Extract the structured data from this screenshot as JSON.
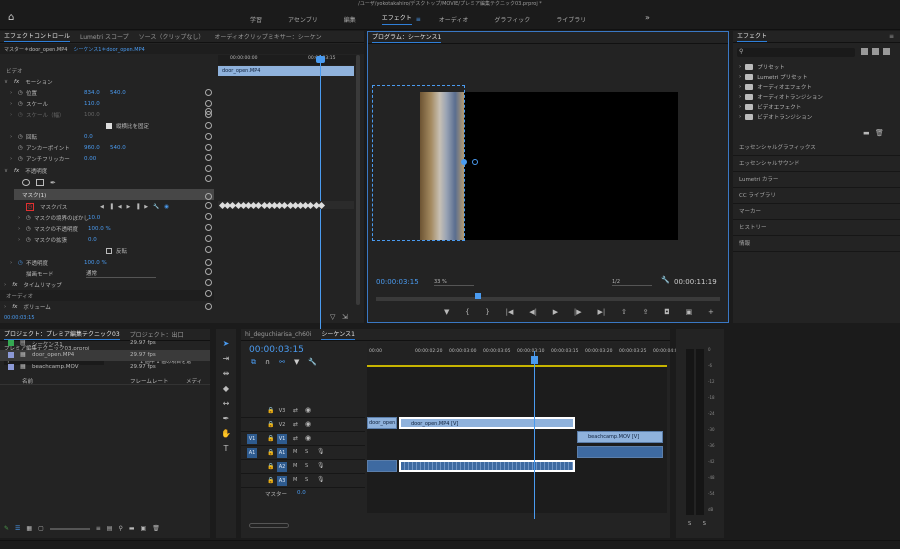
{
  "titlebar": {
    "title": "/ユーザ/yokotakahiro/デスクトップ/MOVIE/プレミア編集テクニック03.prproj *"
  },
  "workspaces": {
    "items": [
      "学習",
      "アセンブリ",
      "編集",
      "エフェクト",
      "オーディオ",
      "グラフィック",
      "ライブラリ"
    ],
    "active": "エフェクト"
  },
  "effect_controls": {
    "tabs": [
      "エフェクトコントロール",
      "Lumetri スコープ",
      "ソース（クリップなし）",
      "オーディオクリップミキサー：シーケン"
    ],
    "master": "マスター＊door_open.MP4",
    "sequence_clip": "シーケンス1＊door_open.MP4",
    "video_label": "ビデオ",
    "ruler_start": "00:00:00:00",
    "ruler_mid": "00:00:03:15",
    "clip_name": "door_open.MP4",
    "motion": "モーション",
    "position_label": "位置",
    "position_x": "834.0",
    "position_y": "540.0",
    "scale_label": "スケール",
    "scale_value": "110.0",
    "scale_width_label": "スケール（幅）",
    "scale_width_value": "100.0",
    "uniform_label": "縦横比を固定",
    "rotation_label": "回転",
    "rotation_value": "0.0",
    "anchor_label": "アンカーポイント",
    "anchor_x": "960.0",
    "anchor_y": "540.0",
    "flicker_label": "アンチフリッカー",
    "flicker_value": "0.00",
    "opacity_section": "不透明度",
    "mask_label": "マスク(1)",
    "mask_path_label": "マスクパス",
    "mask_feather_label": "マスクの境界のぼかし",
    "mask_feather_value": "10.0",
    "mask_opacity_label": "マスクの不透明度",
    "mask_opacity_value": "100.0 %",
    "mask_expansion_label": "マスクの拡張",
    "mask_expansion_value": "0.0",
    "invert_label": "反転",
    "opacity_label": "不透明度",
    "opacity_value": "100.0 %",
    "blend_label": "描画モード",
    "blend_value": "通常",
    "time_remap": "タイムリマップ",
    "audio_label": "オーディオ",
    "volume_label": "ボリューム",
    "timecode": "00:00:03:15"
  },
  "program": {
    "title": "プログラム：シーケンス1",
    "timecode": "00:00:03:15",
    "zoom": "33 %",
    "quality": "1/2",
    "duration": "00:00:11:19"
  },
  "effects": {
    "title": "エフェクト",
    "tree": [
      "プリセット",
      "Lumetri プリセット",
      "オーディオエフェクト",
      "オーディオトランジション",
      "ビデオエフェクト",
      "ビデオトランジション"
    ],
    "sections": [
      "エッセンシャルグラフィックス",
      "エッセンシャルサウンド",
      "Lumetri カラー",
      "CC ライブラリ",
      "マーカー",
      "ヒストリー",
      "情報"
    ]
  },
  "project": {
    "tabs": [
      "プロジェクト：プレミア編集テクニック03",
      "プロジェクト：出口"
    ],
    "path": "プレミア編集テクニック03.prproj",
    "selection_info": "1 個中 1 個の項目を選",
    "col_name": "名前",
    "col_fps": "フレームレート",
    "col_media": "メディ",
    "items": [
      {
        "name": "シーケンス1",
        "fps": "29.97 fps",
        "color": "#35a852"
      },
      {
        "name": "door_open.MP4",
        "fps": "29.97 fps",
        "color": "#8c99d6"
      },
      {
        "name": "beachcamp.MOV",
        "fps": "29.97 fps",
        "color": "#8c99d6"
      }
    ]
  },
  "timeline": {
    "tabs": [
      "hi_deguchiarisa_ch60i",
      "シーケンス1"
    ],
    "timecode": "00:00:03:15",
    "ruler": [
      "00:00",
      "00:00:02:20",
      "00:00:03:00",
      "00:00:03:05",
      "00:00:03:10",
      "00:00:03:15",
      "00:00:03:20",
      "00:00:03:25",
      "00:00:04:00"
    ],
    "tracks": [
      "V3",
      "V2",
      "V1",
      "A1",
      "A2",
      "A3"
    ],
    "src_v": "V1",
    "src_a": "A1",
    "master_label": "マスター",
    "master_value": "0.0",
    "clips": {
      "prev": "door_open.MP4 [V]",
      "main": "door_open.MP4 [V]",
      "next": "beachcamp.MOV [V]"
    }
  },
  "meter": {
    "labels": [
      "0",
      "-6",
      "-12",
      "-18",
      "-24",
      "-30",
      "-36",
      "-42",
      "-48",
      "-54",
      "dB"
    ],
    "bottom": "S S"
  }
}
